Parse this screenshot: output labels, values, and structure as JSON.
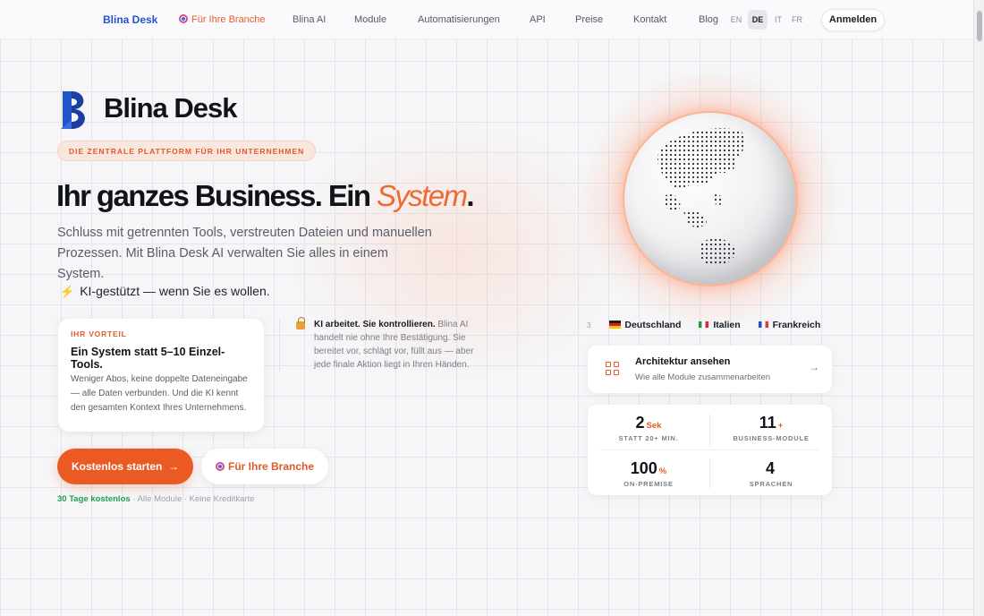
{
  "nav": {
    "brand": "Blina Desk",
    "branche": "Für Ihre Branche",
    "items": [
      "Blina AI",
      "Module",
      "Automatisierungen",
      "API",
      "Preise",
      "Kontakt",
      "Blog"
    ],
    "languages": [
      "EN",
      "DE",
      "IT",
      "FR"
    ],
    "active_language": "DE",
    "login": "Anmelden"
  },
  "hero": {
    "logo_text": "Blina Desk",
    "tag": "DIE ZENTRALE PLATTFORM FÜR IHR UNTERNEHMEN",
    "headline_start": "Ihr ganzes Business. Ein ",
    "headline_em": "System",
    "headline_end": ".",
    "subline": "Schluss mit getrennten Tools, verstreuten Dateien und manuellen Prozessen. Mit Blina Desk AI verwalten Sie alles in einem System.",
    "ki_line": "KI-gestützt — wenn Sie es wollen."
  },
  "vorteil": {
    "label": "IHR VORTEIL",
    "title": "Ein System statt 5–10 Einzel-Tools.",
    "text": "Weniger Abos, keine doppelte Dateneingabe — alle Daten verbunden. Und die KI kennt den gesamten Kontext Ihres Unternehmens."
  },
  "ki_control": {
    "bold": "KI arbeitet. Sie kontrollieren.",
    "text": " Blina AI handelt nie ohne Ihre Bestätigung. Sie bereitet vor, schlägt vor, füllt aus — aber jede finale Aktion liegt in Ihren Händen."
  },
  "cta": {
    "primary": "Kostenlos starten",
    "primary_arrow": "→",
    "secondary": "Für Ihre Branche"
  },
  "fine": {
    "trial": "30 Tage kostenlos",
    "rest": " · Alle Module · Keine Kreditkarte"
  },
  "countries": {
    "prefix": "3",
    "items": [
      "Deutschland",
      "Italien",
      "Frankreich"
    ]
  },
  "architecture": {
    "title": "Architektur ansehen",
    "subtitle": "Wie alle Module zusammenarbeiten",
    "arrow": "→"
  },
  "stats": [
    {
      "num": "2",
      "unit": "Sek",
      "label": "STATT 20+ MIN."
    },
    {
      "num": "11",
      "unit": "+",
      "label": "BUSINESS-MODULE"
    },
    {
      "num": "100",
      "unit": "%",
      "label": "ON-PREMISE"
    },
    {
      "num": "4",
      "unit": "",
      "label": "SPRACHEN"
    }
  ],
  "colors": {
    "accent": "#ea5a22",
    "brand_blue": "#2354c9",
    "text": "#11131a"
  }
}
